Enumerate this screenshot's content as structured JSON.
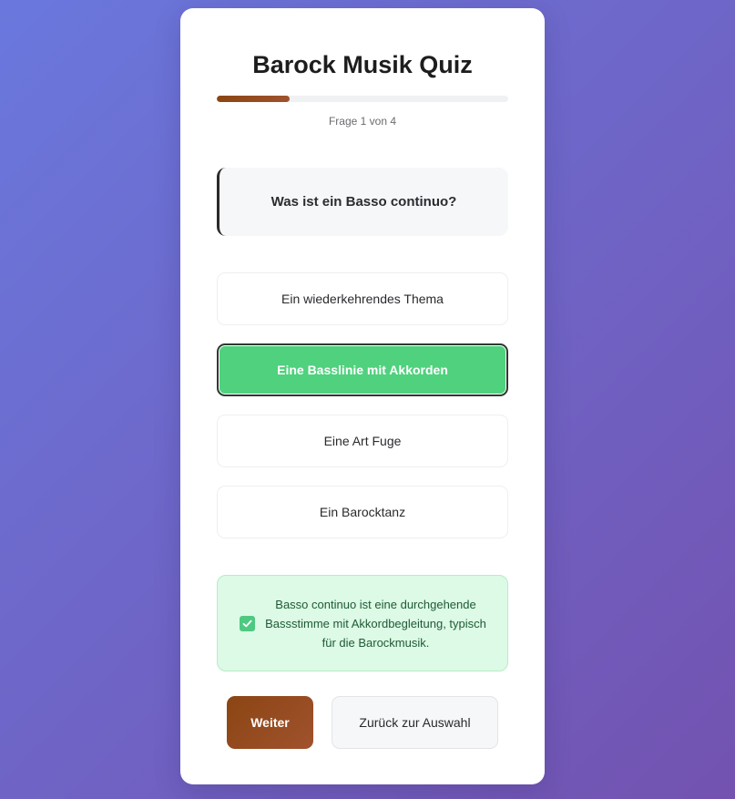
{
  "quiz": {
    "title": "Barock Musik Quiz",
    "progress": {
      "text": "Frage 1 von 4",
      "fraction": 0.25,
      "current": 1,
      "total": 4
    },
    "question": "Was ist ein Basso continuo?",
    "options": [
      {
        "label": "Ein wiederkehrendes Thema",
        "selected": false
      },
      {
        "label": "Eine Basslinie mit Akkorden",
        "selected": true
      },
      {
        "label": "Eine Art Fuge",
        "selected": false
      },
      {
        "label": "Ein Barocktanz",
        "selected": false
      }
    ],
    "feedback": {
      "icon": "check-icon",
      "text": "Basso continuo ist eine durchgehende Bassstimme mit Akkordbegleitung, typisch für die Barockmusik."
    },
    "buttons": {
      "next": "Weiter",
      "back": "Zurück zur Auswahl"
    }
  },
  "colors": {
    "accent": "#8b4513",
    "correct": "#4fd17d",
    "feedback_bg": "#dcfae6",
    "feedback_text": "#1f5a36"
  }
}
